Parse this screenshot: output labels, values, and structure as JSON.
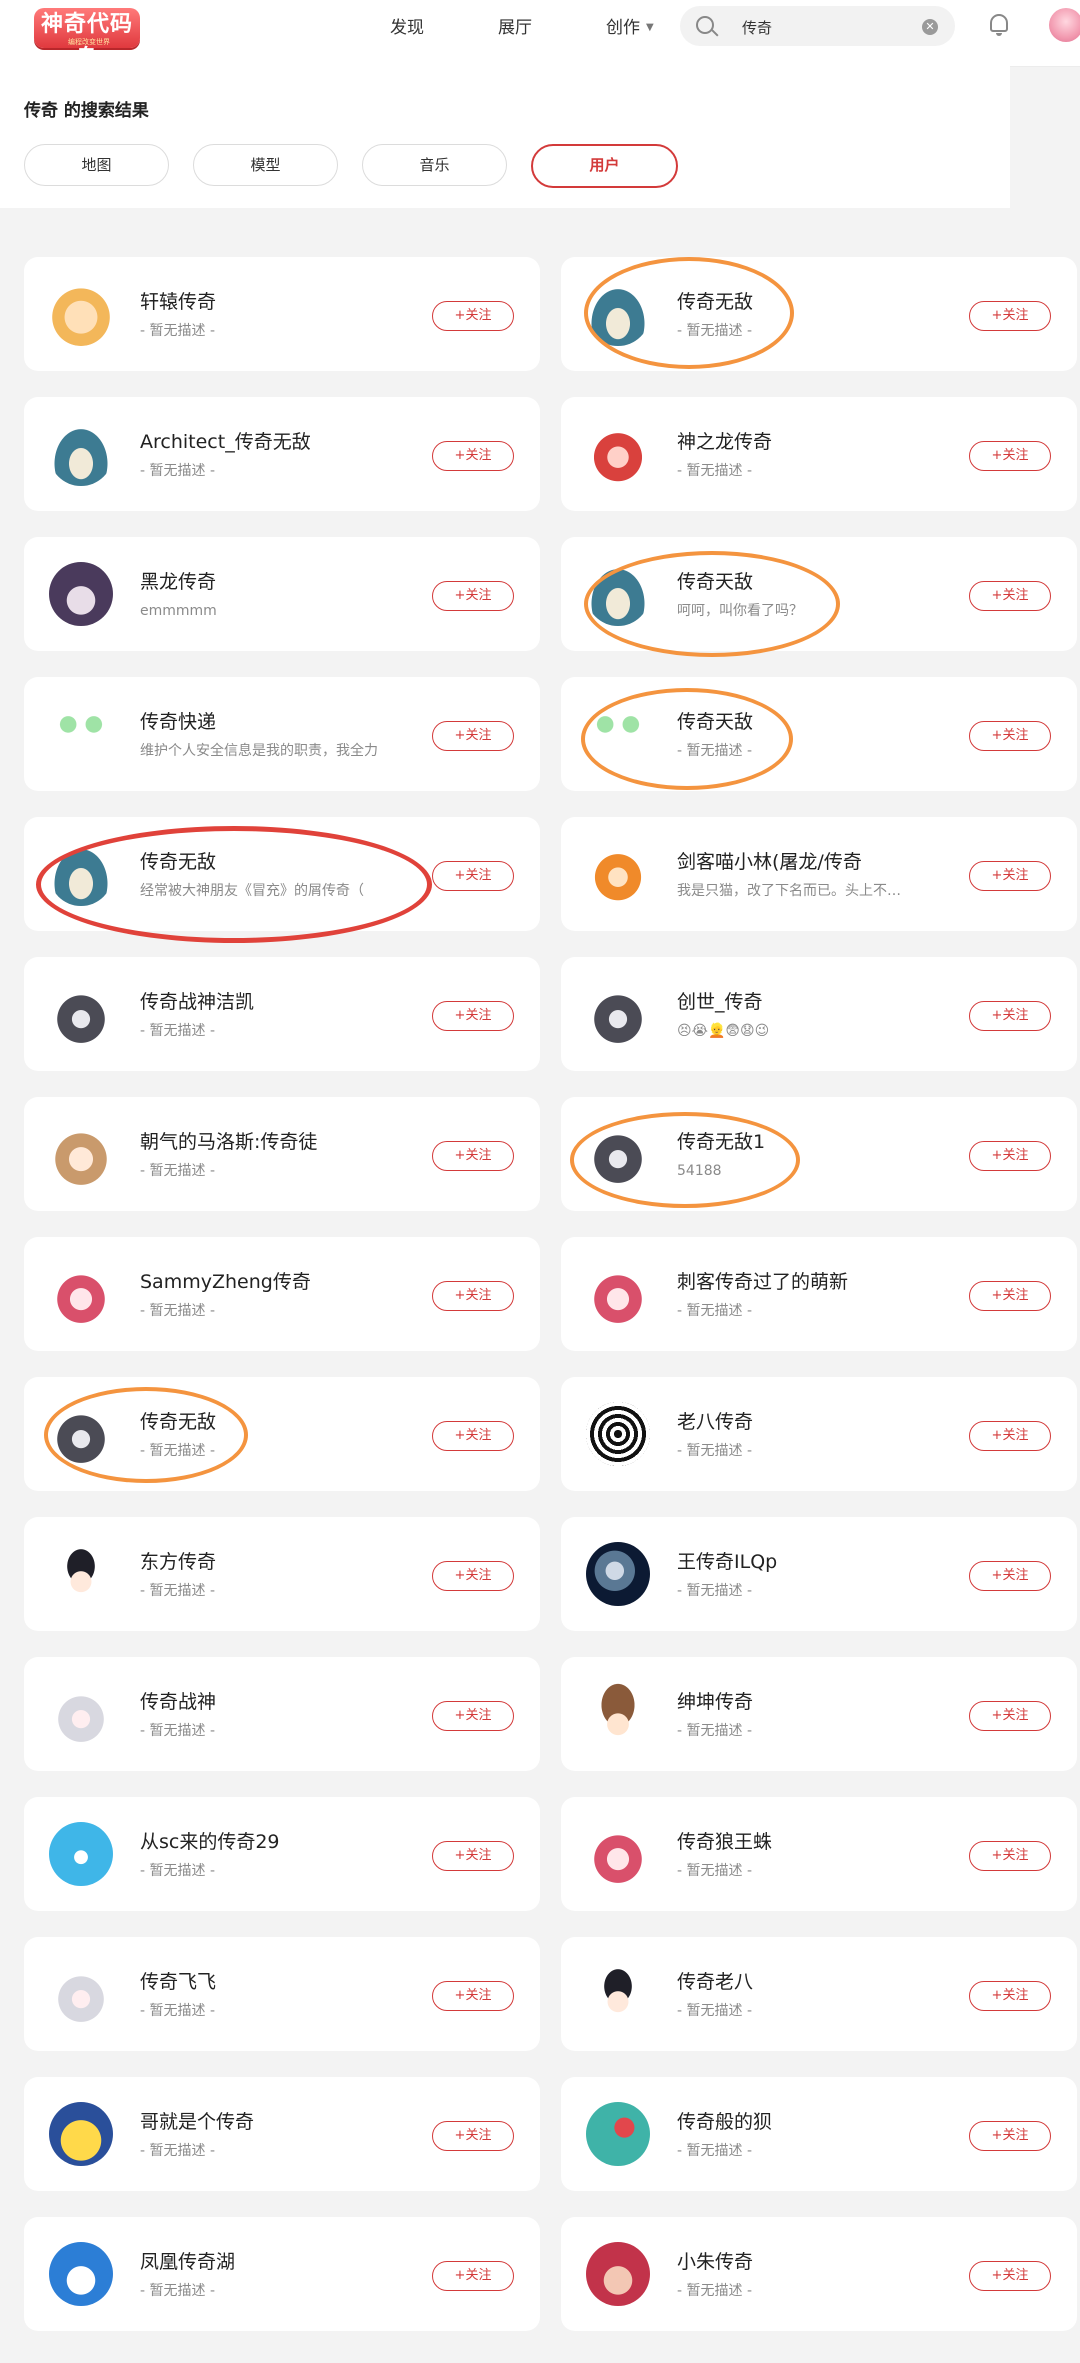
{
  "header": {
    "logo_text": "神奇代码岛",
    "logo_sub": "编程改变世界",
    "nav": [
      "发现",
      "展厅",
      "创作"
    ],
    "search_value": "传奇"
  },
  "results": {
    "title": "传奇 的搜索结果",
    "filters": [
      "地图",
      "模型",
      "音乐",
      "用户"
    ],
    "active_filter": "用户"
  },
  "follow_label": "+关注",
  "users": [
    {
      "name": "轩辕传奇",
      "desc": "- 暂无描述 -",
      "avatar": "deer-avatar"
    },
    {
      "name": "传奇无敌",
      "desc": "- 暂无描述 -",
      "avatar": "snorlax-avatar"
    },
    {
      "name": "Architect_传奇无敌",
      "desc": "- 暂无描述 -",
      "avatar": "snorlax-avatar"
    },
    {
      "name": "神之龙传奇",
      "desc": "- 暂无描述 -",
      "avatar": "red-dragon-avatar"
    },
    {
      "name": "黑龙传奇",
      "desc": "emmmmm",
      "avatar": "dark-hair-avatar"
    },
    {
      "name": "传奇天敌",
      "desc": "呵呵，叫你看了吗？",
      "avatar": "snorlax-avatar"
    },
    {
      "name": "传奇快递",
      "desc": "维护个人安全信息是我的职责，我全力",
      "avatar": "green-ghost-avatar"
    },
    {
      "name": "传奇天敌",
      "desc": "- 暂无描述 -",
      "avatar": "green-ghost-avatar"
    },
    {
      "name": "传奇无敌",
      "desc": "经常被大神朋友《冒充》的屑传奇（",
      "avatar": "snorlax-avatar"
    },
    {
      "name": "剑客喵小林(屠龙/传奇",
      "desc": "我是只猫，改了下名而已。头上不…",
      "avatar": "orange-cat-avatar"
    },
    {
      "name": "传奇战神洁凯",
      "desc": "- 暂无描述 -",
      "avatar": "grey-wolf-avatar"
    },
    {
      "name": "创世_传奇",
      "desc": "😣😭👱😨😧😉",
      "avatar": "grey-wolf-avatar"
    },
    {
      "name": "朝气的马洛斯:传奇徒",
      "desc": "- 暂无描述 -",
      "avatar": "fox-girl-avatar"
    },
    {
      "name": "传奇无敌1",
      "desc": "54188",
      "avatar": "grey-wolf-avatar"
    },
    {
      "name": "SammyZheng传奇",
      "desc": "- 暂无描述 -",
      "avatar": "pink-hair-avatar"
    },
    {
      "name": "刺客传奇过了的萌新",
      "desc": "- 暂无描述 -",
      "avatar": "pink-hair-avatar"
    },
    {
      "name": "传奇无敌",
      "desc": "- 暂无描述 -",
      "avatar": "grey-wolf-avatar"
    },
    {
      "name": "老八传奇",
      "desc": "- 暂无描述 -",
      "avatar": "spiral-avatar"
    },
    {
      "name": "东方传奇",
      "desc": "- 暂无描述 -",
      "avatar": "black-hat-avatar"
    },
    {
      "name": "王传奇ILQp",
      "desc": "- 暂无描述 -",
      "avatar": "moon-avatar"
    },
    {
      "name": "传奇战神",
      "desc": "- 暂无描述 -",
      "avatar": "white-hair-avatar"
    },
    {
      "name": "绅坤传奇",
      "desc": "- 暂无描述 -",
      "avatar": "cowboy-hat-avatar"
    },
    {
      "name": "从sc来的传奇29",
      "desc": "- 暂无描述 -",
      "avatar": "blue-creature-avatar"
    },
    {
      "name": "传奇狼王蛛",
      "desc": "- 暂无描述 -",
      "avatar": "pink-hair-avatar"
    },
    {
      "name": "传奇飞飞",
      "desc": "- 暂无描述 -",
      "avatar": "white-hair-avatar"
    },
    {
      "name": "传奇老八",
      "desc": "- 暂无描述 -",
      "avatar": "black-hat-avatar"
    },
    {
      "name": "哥就是个传奇",
      "desc": "- 暂无描述 -",
      "avatar": "yellow-duck-avatar"
    },
    {
      "name": "传奇般的狈",
      "desc": "- 暂无描述 -",
      "avatar": "teal-bird-avatar"
    },
    {
      "name": "凤凰传奇湖",
      "desc": "- 暂无描述 -",
      "avatar": "blue-cartoon-avatar"
    },
    {
      "name": "小朱传奇",
      "desc": "- 暂无描述 -",
      "avatar": "baby-photo-avatar"
    }
  ],
  "colors": {
    "accent": "#d33a3a",
    "highlight_orange": "#f4943f",
    "highlight_red": "#e0423a"
  }
}
